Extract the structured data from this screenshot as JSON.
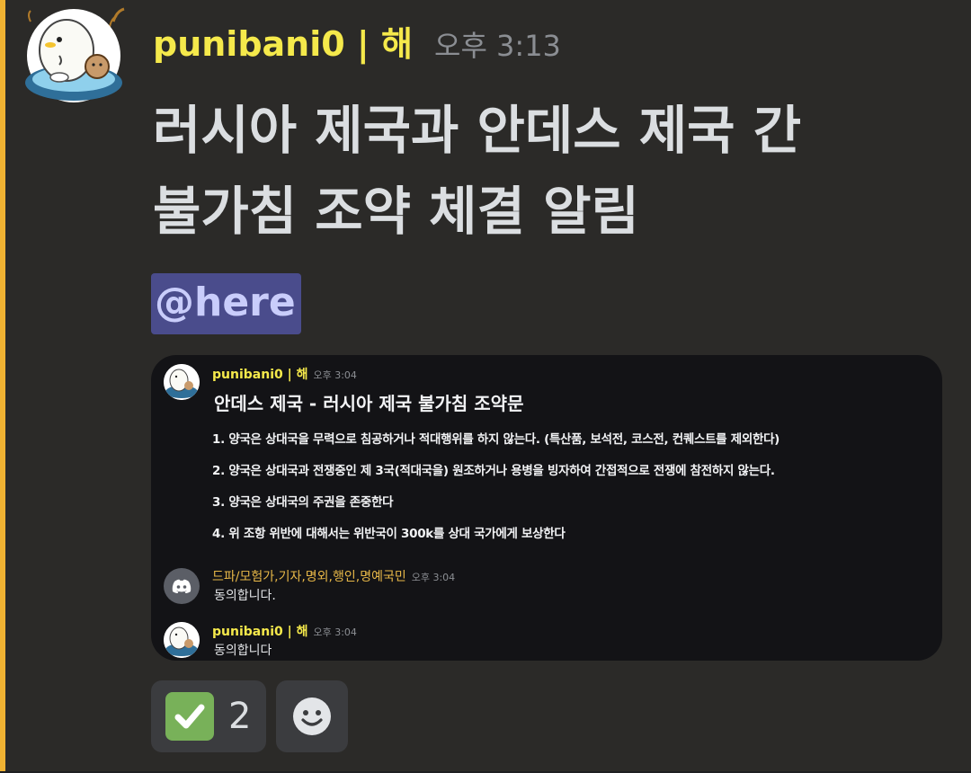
{
  "message": {
    "username": "punibani0 | 해",
    "timestamp": "오후 3:13",
    "title_line1": "러시아 제국과 안데스 제국 간",
    "title_line2": "불가침 조약 체결 알림",
    "mention": "@here"
  },
  "embed": {
    "msg1": {
      "username": "punibani0 | 해",
      "timestamp": "오후 3:04",
      "title": "안데스 제국 - 러시아 제국 불가침 조약문",
      "items": [
        "1. 양국은 상대국을 무력으로 침공하거나 적대행위를 하지 않는다. (특산품, 보석전, 코스전, 컨퀘스트를 제외한다)",
        "2. 양국은 상대국과 전쟁중인 제 3국(적대국을) 원조하거나 용병을 빙자하여 간접적으로 전쟁에 참전하지 않는다.",
        "3. 양국은 상대국의 주권을 존중한다",
        "4. 위 조항 위반에 대해서는 위반국이 300k를 상대 국가에게 보상한다"
      ]
    },
    "msg2": {
      "username": "드파/모험가,기자,명외,행인,명예국민",
      "timestamp": "오후 3:04",
      "text": "동의합니다."
    },
    "msg3": {
      "username": "punibani0 | 해",
      "timestamp": "오후 3:04",
      "text": "동의합니다"
    }
  },
  "reactions": {
    "check_count": "2",
    "check_icon": "white-check-mark-icon",
    "add_icon": "add-reaction-icon"
  },
  "colors": {
    "accent_bar": "#f0b232",
    "username": "#f5e94b",
    "mention_bg": "#4a4c8c",
    "background": "#2b2a28"
  }
}
